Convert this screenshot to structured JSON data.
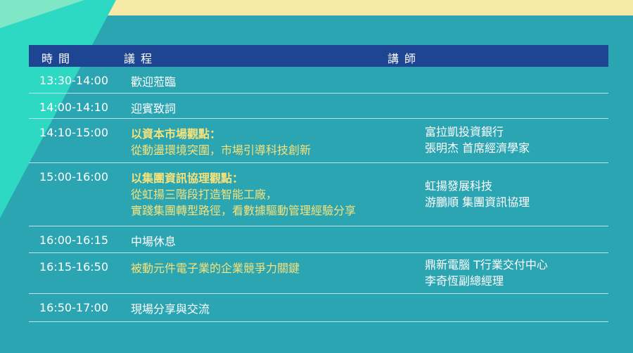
{
  "header": {
    "time": "時間",
    "topic": "議程",
    "speaker": "講師"
  },
  "rows": [
    {
      "time": "13:30-14:00",
      "topic": [
        "歡迎蒞臨"
      ],
      "speaker": []
    },
    {
      "time": "14:00-14:10",
      "topic": [
        "迎賓致詞"
      ],
      "speaker": []
    },
    {
      "time": "14:10-15:00",
      "topic": [
        "以資本市場觀點：",
        "從動盪環境突圍，市場引導科技創新"
      ],
      "speaker": [
        "富拉凱投資銀行",
        "張明杰 首席經濟學家"
      ]
    },
    {
      "time": "15:00-16:00",
      "topic": [
        "以集團資訊協理觀點：",
        "從虹揚三階段打造智能工廠，",
        "實踐集團轉型路徑，看數據驅動管理經驗分享"
      ],
      "speaker": [
        "虹揚發展科技",
        "游鵬順  集團資訊協理"
      ]
    },
    {
      "time": "16:00-16:15",
      "topic": [
        "中場休息"
      ],
      "speaker": []
    },
    {
      "time": "16:15-16:50",
      "topic": [
        "被動元件電子業的企業競爭力關鍵"
      ],
      "speaker": [
        "鼎新電腦 T行業交付中心",
        "李奇恆副總經理"
      ]
    },
    {
      "time": "16:50-17:00",
      "topic": [
        "現場分享與交流"
      ],
      "speaker": []
    }
  ],
  "colors": {
    "background": "#2ca5b3",
    "header": "#1e4592",
    "highlight": "#f5e27a"
  }
}
